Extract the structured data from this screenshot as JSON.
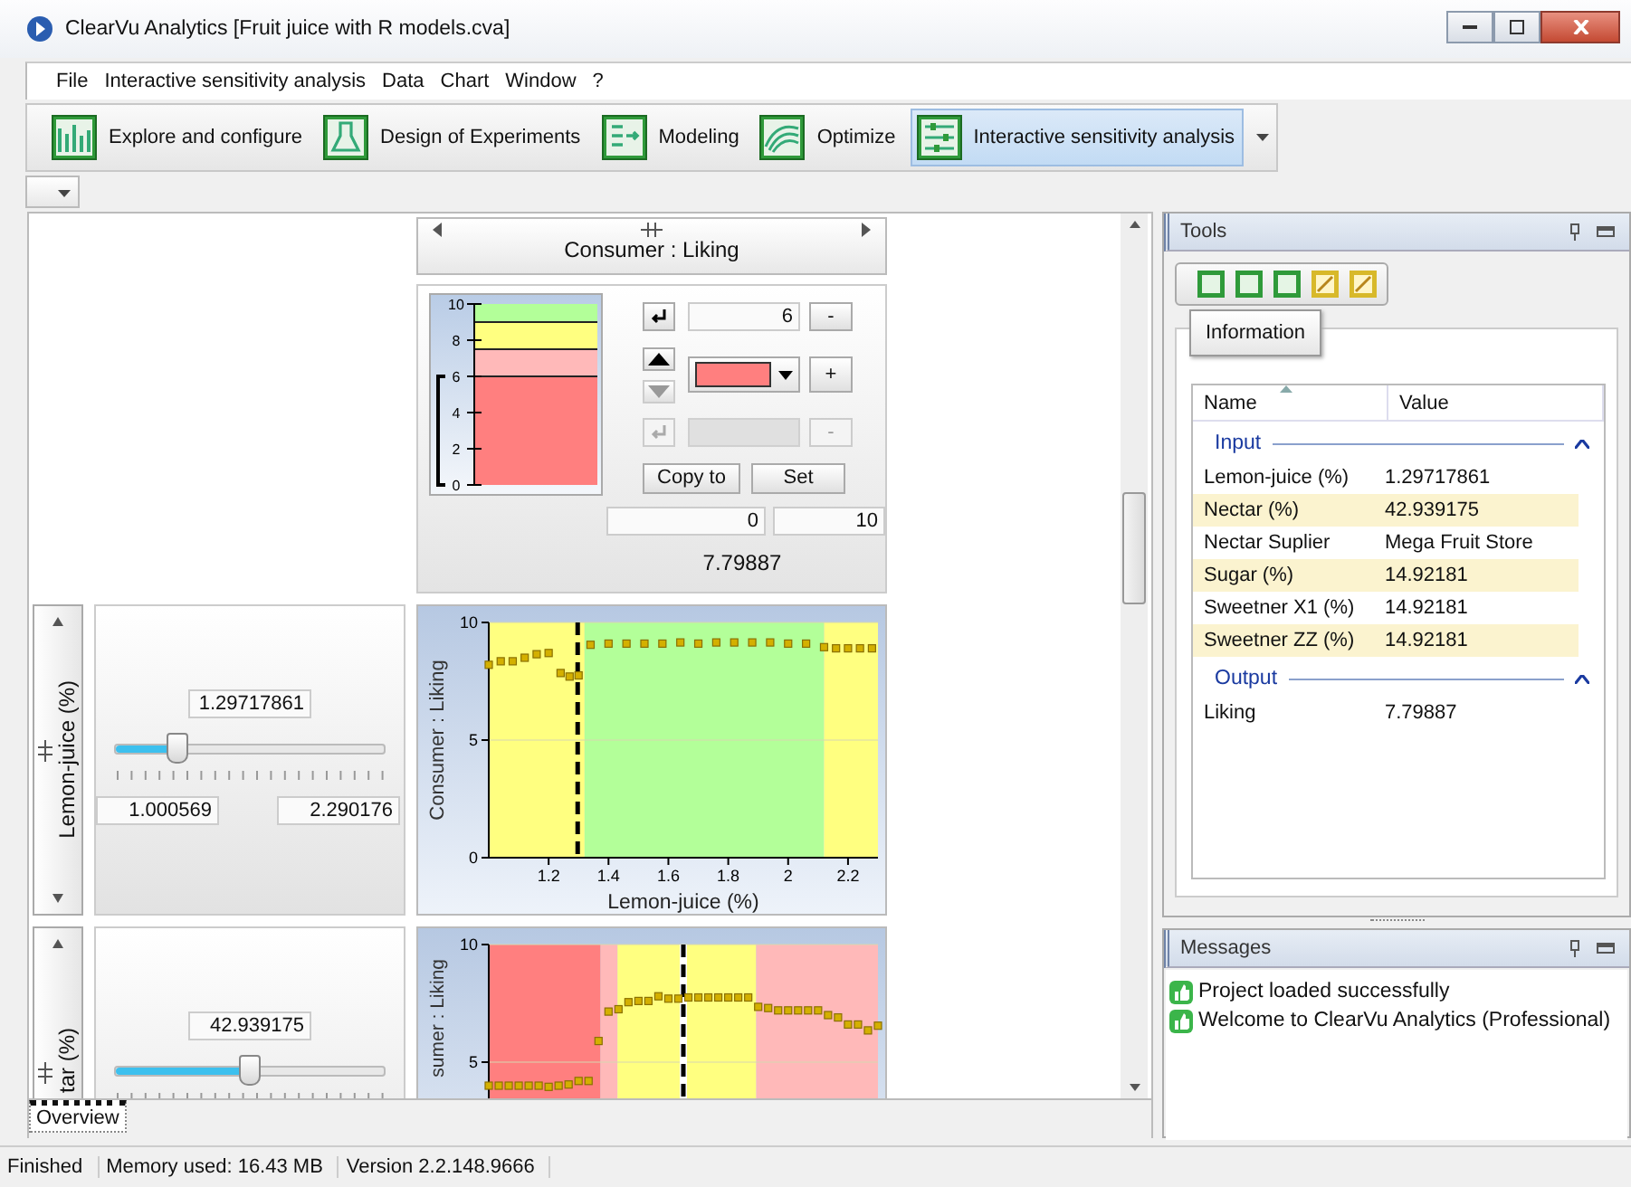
{
  "window": {
    "title": "ClearVu Analytics [Fruit juice with R models.cva]"
  },
  "menu": [
    "File",
    "Interactive sensitivity analysis",
    "Data",
    "Chart",
    "Window",
    "?"
  ],
  "toolbar": [
    {
      "label": "Explore and configure",
      "kind": "explore",
      "selected": false
    },
    {
      "label": "Design of Experiments",
      "kind": "doe",
      "selected": false
    },
    {
      "label": "Modeling",
      "kind": "modeling",
      "selected": false
    },
    {
      "label": "Optimize",
      "kind": "optimize",
      "selected": false
    },
    {
      "label": "Interactive sensitivity analysis",
      "kind": "sensitivity",
      "selected": true
    }
  ],
  "response": {
    "title": "Consumer : Liking",
    "scale": {
      "chart_data": {
        "type": "bar",
        "stacked": true,
        "categories": [
          null
        ],
        "ylim": [
          0,
          10
        ],
        "yticks": [
          {
            "value": 0,
            "label": "0"
          },
          {
            "value": 2,
            "label": "2"
          },
          {
            "value": 4,
            "label": "4"
          },
          {
            "value": 6,
            "label": "6"
          },
          {
            "value": 8,
            "label": "8"
          },
          {
            "value": 10,
            "label": "10"
          }
        ],
        "series": [
          {
            "color": "#ff7f7f",
            "values": [
              6
            ]
          },
          {
            "color": "#ffb9b9",
            "values": [
              1.5
            ]
          },
          {
            "color": "#ffff80",
            "values": [
              1.5
            ]
          },
          {
            "color": "#b3ff99",
            "values": [
              1
            ]
          }
        ]
      },
      "bands": [
        {
          "selected": true
        },
        {
          "selected": false
        },
        {
          "selected": false
        },
        {
          "selected": false
        }
      ]
    },
    "rows": [
      {
        "value": "6",
        "button": "-",
        "disabled": false
      },
      {
        "button": "-",
        "disabled": true
      }
    ],
    "add_button": "+",
    "copy_button": "Copy to",
    "set_button": "Set",
    "min": "0",
    "max": "10",
    "current": "7.79887"
  },
  "factors": [
    {
      "label": "Lemon-juice (%)",
      "value": "1.29717861",
      "min": "1.000569",
      "max": "2.290176",
      "level": 0.23,
      "chart_data": {
        "type": "scatter",
        "xlabel": "Lemon-juice (%)",
        "ylabel": "Consumer : Liking",
        "xlim": [
          1.0,
          2.3
        ],
        "ylim": [
          0,
          10
        ],
        "xticks": [
          {
            "value": 1.2,
            "label": "1.2"
          },
          {
            "value": 1.4,
            "label": "1.4"
          },
          {
            "value": 1.6,
            "label": "1.6"
          },
          {
            "value": 1.8,
            "label": "1.8"
          },
          {
            "value": 2,
            "label": "2"
          },
          {
            "value": 2.2,
            "label": "2.2"
          }
        ],
        "yticks": [
          {
            "value": 0,
            "label": "0"
          },
          {
            "value": 5,
            "label": "5"
          },
          {
            "value": 10,
            "label": "10"
          }
        ],
        "x": [
          1.0,
          1.04,
          1.08,
          1.12,
          1.16,
          1.2,
          1.24,
          1.27,
          1.3,
          1.34,
          1.4,
          1.46,
          1.52,
          1.58,
          1.64,
          1.7,
          1.76,
          1.82,
          1.88,
          1.94,
          2.0,
          2.06,
          2.12,
          2.16,
          2.2,
          2.24,
          2.28
        ],
        "series": [
          {
            "color": "#d4b000",
            "values": [
              8.2,
              8.35,
              8.35,
              8.5,
              8.65,
              8.7,
              7.85,
              7.7,
              7.75,
              9.05,
              9.1,
              9.1,
              9.1,
              9.1,
              9.15,
              9.1,
              9.15,
              9.15,
              9.15,
              9.15,
              9.1,
              9.1,
              8.95,
              8.9,
              8.9,
              8.9,
              8.9
            ]
          }
        ],
        "bands": [
          {
            "axis": "x",
            "from": 1.0,
            "to": 1.32,
            "color": "#ffff80"
          },
          {
            "axis": "x",
            "from": 1.32,
            "to": 2.12,
            "color": "#b3ff99"
          },
          {
            "axis": "x",
            "from": 2.12,
            "to": 2.3,
            "color": "#ffff80"
          }
        ],
        "ref_lines": [
          {
            "value": 1.297,
            "axis": "x",
            "color": "#000000"
          }
        ]
      }
    },
    {
      "label": "tar (%)",
      "value": "42.939175",
      "level": 0.5,
      "chart": {
        "ylabel": "sumer : Liking",
        "yticks": [
          "10",
          "5"
        ]
      }
    }
  ],
  "doc_tabs": [
    {
      "label": "Overview",
      "selected": true
    }
  ],
  "tools": {
    "title": "Tools",
    "buttons": [
      {
        "kind": "green"
      },
      {
        "kind": "green"
      },
      {
        "kind": "green"
      },
      {
        "kind": "yellow"
      },
      {
        "kind": "yellow"
      }
    ],
    "tooltip": "Information",
    "columns": [
      "Name",
      "Value"
    ],
    "groups": [
      {
        "title": "Input",
        "expanded": true,
        "rows": [
          {
            "name": "Lemon-juice (%)",
            "value": "1.29717861"
          },
          {
            "name": "Nectar (%)",
            "value": "42.939175"
          },
          {
            "name": "Nectar Suplier",
            "value": "Mega Fruit Store"
          },
          {
            "name": "Sugar (%)",
            "value": "14.92181"
          },
          {
            "name": "Sweetner X1 (%)",
            "value": "14.92181"
          },
          {
            "name": "Sweetner ZZ (%)",
            "value": "14.92181"
          }
        ]
      },
      {
        "title": "Output",
        "expanded": true,
        "rows": [
          {
            "name": "Liking",
            "value": "7.79887"
          }
        ]
      }
    ]
  },
  "messages": {
    "title": "Messages",
    "items": [
      "Project loaded successfully",
      "Welcome to ClearVu Analytics (Professional)"
    ]
  },
  "status_bar": [
    "Finished",
    "Memory used: 16.43 MB",
    "Version 2.2.148.9666"
  ]
}
